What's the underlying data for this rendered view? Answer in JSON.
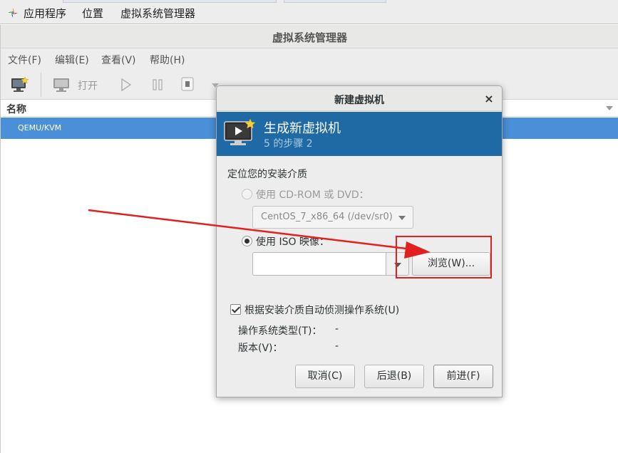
{
  "topbar": {
    "applications": "应用程序",
    "places": "位置",
    "active_app": "虚拟系统管理器"
  },
  "window": {
    "title": "虚拟系统管理器",
    "menu": [
      "文件(F)",
      "编辑(E)",
      "查看(V)",
      "帮助(H)"
    ],
    "toolbar": {
      "new_vm_icon": "monitor-new-icon",
      "open_label": "打开",
      "run_icon": "play-icon",
      "pause_icon": "pause-icon",
      "stop_icon": "stop-icon"
    },
    "list": {
      "column_name": "名称",
      "rows": [
        "QEMU/KVM"
      ]
    }
  },
  "dialog": {
    "title": "新建虚拟机",
    "banner_title": "生成新虚拟机",
    "banner_step": "5 的步骤 2",
    "section_label": "定位您的安装介质",
    "option_cdrom": "使用  CD-ROM 或  DVD：",
    "cdrom_device": "CentOS_7_x86_64 (/dev/sr0)",
    "option_iso": "使用  ISO 映像：",
    "iso_path": "",
    "browse_label": "浏览(W)...",
    "autodetect_label": "根据安装介质自动侦测操作系统(U)",
    "autodetect_checked": true,
    "os_type_label": "操作系统类型(T)：",
    "os_type_value": "-",
    "version_label": "版本(V)：",
    "version_value": "-",
    "cancel_label": "取消(C)",
    "back_label": "后退(B)",
    "forward_label": "前进(F)",
    "selected_option": "iso"
  },
  "colors": {
    "banner": "#1f6aa5",
    "selection": "#4a90d9",
    "annotation": "#e32020"
  }
}
